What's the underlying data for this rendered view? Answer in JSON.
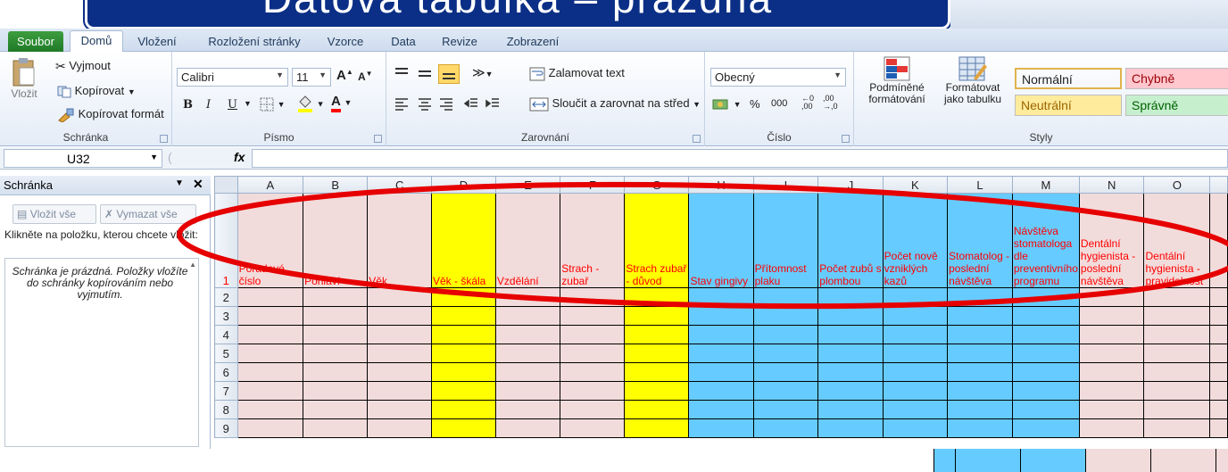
{
  "banner": {
    "title": "Datová tabulka – přázdná"
  },
  "tabs": [
    "Soubor",
    "Domů",
    "Vložení",
    "Rozložení stránky",
    "Vzorce",
    "Data",
    "Revize",
    "Zobrazení"
  ],
  "clipboard": {
    "paste": "Vložit",
    "cut": "Vyjmout",
    "copy": "Kopírovat",
    "format_painter": "Kopírovat formát",
    "label": "Schránka"
  },
  "font": {
    "name": "Calibri",
    "size": "11",
    "grow": "A",
    "shrink": "A",
    "bold": "B",
    "italic": "I",
    "underline": "U",
    "font_color_letter": "A",
    "label": "Písmo"
  },
  "alignment": {
    "wrap": "Zalamovat text",
    "merge": "Sloučit a zarovnat na střed",
    "label": "Zarovnání"
  },
  "number": {
    "format": "Obecný",
    "percent": "%",
    "thousands": "000",
    "label": "Číslo"
  },
  "styles": {
    "conditional": "Podmíněné formátování",
    "as_table": "Formátovat jako tabulku",
    "normal": "Normální",
    "bad": "Chybně",
    "neutral": "Neutrální",
    "good": "Správně",
    "label": "Styly",
    "colors": {
      "normal": "#ffffff",
      "bad": "#ffc7ce",
      "neutral": "#ffeb9c",
      "good": "#c6efce"
    }
  },
  "formula_bar": {
    "name_box": "U32",
    "fx": "fx",
    "content": ""
  },
  "pane": {
    "title": "Schránka",
    "paste_all": "Vložit vše",
    "clear_all": "Vymazat vše",
    "hint": "Klikněte na položku, kterou chcete vložit:",
    "empty": "Schránka je prázdná. Položky vložíte do schránky kopírováním nebo vyjmutím."
  },
  "sheet": {
    "columns": [
      "A",
      "B",
      "C",
      "D",
      "E",
      "F",
      "G",
      "H",
      "I",
      "J",
      "K",
      "L",
      "M",
      "N",
      "O"
    ],
    "headers": [
      "Pořadové číslo",
      "Pohlaví",
      "Věk",
      "Věk - škála",
      "Vzdělání",
      "Strach - zubař",
      "Strach zubař - důvod",
      "Stav gingivy",
      "Přítomnost plaku",
      "Počet zubů s plombou",
      "Počet nově vzniklých kazů",
      "Stomatolog - poslední návštěva",
      "Návštěva stomatologa dle preventivního programu",
      "Dentální hygienista - poslední návštěva",
      "Dentální hygienista - pravidelnost"
    ],
    "rows": [
      "1",
      "2",
      "3",
      "4",
      "5",
      "6",
      "7",
      "8",
      "9"
    ],
    "column_colors": [
      "pink",
      "pink",
      "pink",
      "yellow",
      "pink",
      "pink",
      "yellow",
      "blue",
      "blue",
      "blue",
      "blue",
      "blue",
      "blue",
      "pink",
      "pink"
    ]
  },
  "colors": {
    "pink": "#f2dcdb",
    "yellow": "#ffff00",
    "blue": "#66ccff",
    "header_text": "#ff0000",
    "highlight_oval": "#e60000"
  }
}
